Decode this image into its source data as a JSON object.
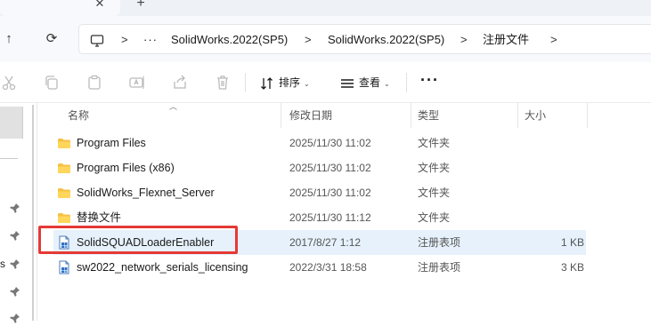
{
  "tabs": {
    "close_glyph": "✕",
    "new_glyph": "+"
  },
  "nav": {
    "up_glyph": "↑",
    "refresh_glyph": "⟳"
  },
  "breadcrumb": {
    "more": "···",
    "sep": ">",
    "items": [
      "SolidWorks.2022(SP5)",
      "SolidWorks.2022(SP5)",
      "注册文件"
    ]
  },
  "toolbar": {
    "sort_label": "排序",
    "view_label": "查看",
    "chevron": "⌄",
    "more": "···"
  },
  "columns": {
    "name": "名称",
    "date": "修改日期",
    "type": "类型",
    "size": "大小"
  },
  "files": [
    {
      "name": "Program Files",
      "date": "2025/11/30 11:02",
      "type": "文件夹",
      "size": "",
      "icon": "folder-icon"
    },
    {
      "name": "Program Files (x86)",
      "date": "2025/11/30 11:02",
      "type": "文件夹",
      "size": "",
      "icon": "folder-icon"
    },
    {
      "name": "SolidWorks_Flexnet_Server",
      "date": "2025/11/30 11:02",
      "type": "文件夹",
      "size": "",
      "icon": "folder-icon"
    },
    {
      "name": "替换文件",
      "date": "2025/11/30 11:12",
      "type": "文件夹",
      "size": "",
      "icon": "folder-icon"
    },
    {
      "name": "SolidSQUADLoaderEnabler",
      "date": "2017/8/27 1:12",
      "type": "注册表项",
      "size": "1 KB",
      "icon": "registry-file-icon",
      "selected": true
    },
    {
      "name": "sw2022_network_serials_licensing",
      "date": "2022/3/31 18:58",
      "type": "注册表项",
      "size": "3 KB",
      "icon": "registry-file-icon"
    }
  ],
  "navpane": {
    "pin_glyph": "📌",
    "partial_letter": "s"
  },
  "colors": {
    "accent": "#0067c0",
    "selection": "#e6f1fb",
    "highlight_box": "#e53935",
    "folder": "#f4c145"
  }
}
